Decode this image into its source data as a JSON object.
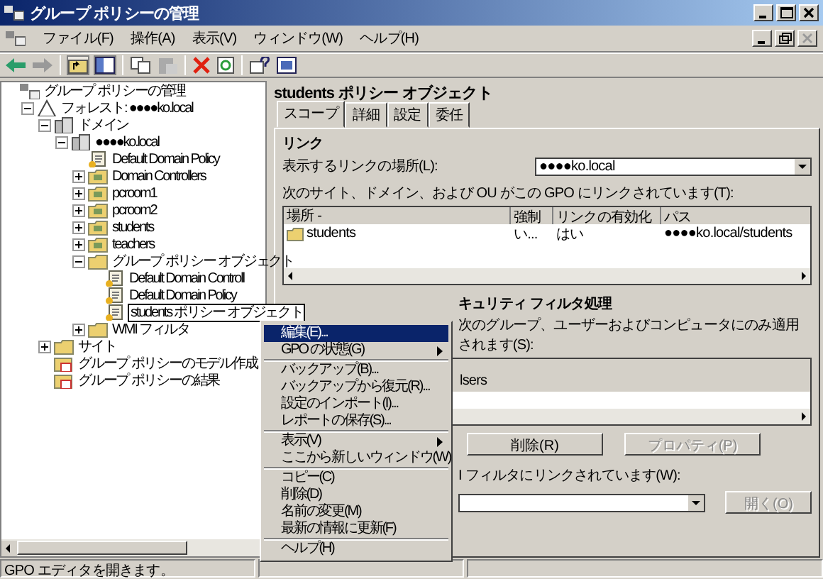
{
  "window": {
    "title": "グループ ポリシーの管理"
  },
  "menu_bar": [
    "ファイル(F)",
    "操作(A)",
    "表示(V)",
    "ウィンドウ(W)",
    "ヘルプ(H)"
  ],
  "tree": [
    {
      "label": "グループ ポリシーの管理",
      "kind": "root",
      "selected": false,
      "children": [
        {
          "label": "フォレスト: ●●●●ko.local",
          "kind": "forest",
          "expanded": true,
          "selected": false,
          "children": [
            {
              "label": "ドメイン",
              "kind": "domains",
              "expanded": true,
              "selected": false,
              "children": [
                {
                  "label": "●●●●ko.local",
                  "kind": "domain",
                  "expanded": true,
                  "selected": false,
                  "children": [
                    {
                      "label": "Default Domain Policy",
                      "kind": "gpo",
                      "selected": false
                    },
                    {
                      "label": "Domain Controllers",
                      "kind": "ou",
                      "expanded": false,
                      "selected": false
                    },
                    {
                      "label": "pcroom1",
                      "kind": "ou",
                      "expanded": false,
                      "selected": false
                    },
                    {
                      "label": "pcroom2",
                      "kind": "ou",
                      "expanded": false,
                      "selected": false
                    },
                    {
                      "label": "students",
                      "kind": "ou",
                      "expanded": false,
                      "selected": false
                    },
                    {
                      "label": "teachers",
                      "kind": "ou",
                      "expanded": false,
                      "selected": false
                    },
                    {
                      "label": "グループ ポリシー オブジェクト",
                      "kind": "folder",
                      "expanded": true,
                      "selected": false,
                      "children": [
                        {
                          "label": "Default Domain Controll",
                          "kind": "gpo",
                          "selected": false
                        },
                        {
                          "label": "Default Domain Policy",
                          "kind": "gpo",
                          "selected": false
                        },
                        {
                          "label": "students ポリシー オブジェクト",
                          "kind": "gpo",
                          "selected": true
                        }
                      ]
                    },
                    {
                      "label": "WMI フィルタ",
                      "kind": "folder",
                      "expanded": false,
                      "selected": false
                    }
                  ]
                }
              ]
            },
            {
              "label": "サイト",
              "kind": "folder",
              "expanded": false,
              "selected": false
            },
            {
              "label": "グループ ポリシーのモデル作成",
              "kind": "report",
              "selected": false
            },
            {
              "label": "グループ ポリシーの結果",
              "kind": "report",
              "selected": false
            }
          ]
        }
      ]
    }
  ],
  "details": {
    "title": "students ポリシー オブジェクト",
    "tabs": [
      {
        "label": "スコープ",
        "selected": true
      },
      {
        "label": "詳細",
        "selected": false
      },
      {
        "label": "設定",
        "selected": false
      },
      {
        "label": "委任",
        "selected": false
      }
    ],
    "links_heading": "リンク",
    "location_label": "表示するリンクの場所(L):",
    "location_value": "●●●●ko.local",
    "links_caption": "次のサイト、ドメイン、および OU がこの GPO にリンクされています(T):",
    "links_table": {
      "columns": [
        "場所  -",
        "強制",
        "リンクの有効化",
        "パス"
      ],
      "rows": [
        [
          "students",
          "い...",
          "はい",
          "●●●●ko.local/students"
        ]
      ]
    },
    "security_heading": "キュリティ フィルタ処理",
    "security_caption": "次のグループ、ユーザーおよびコンピュータにのみ適用されます(S):",
    "security_rows": [
      "lsers"
    ],
    "buttons": [
      {
        "label": "削除(R)",
        "disabled": false
      },
      {
        "label": "プロパティ(P)",
        "disabled": true
      }
    ],
    "wmi_caption": "I フィルタにリンクされています(W):",
    "open_button": {
      "label": "開く(O)",
      "disabled": true
    }
  },
  "context_menu": [
    {
      "label": "編集(E)...",
      "kind": "item",
      "selected": true
    },
    {
      "label": "GPO の状態(G)",
      "kind": "submenu",
      "selected": false
    },
    {
      "kind": "separator"
    },
    {
      "label": "バックアップ(B)...",
      "kind": "item",
      "selected": false
    },
    {
      "label": "バックアップから復元(R)...",
      "kind": "item",
      "selected": false
    },
    {
      "label": "設定のインポート(I)...",
      "kind": "item",
      "selected": false
    },
    {
      "label": "レポートの保存(S)...",
      "kind": "item",
      "selected": false
    },
    {
      "kind": "separator"
    },
    {
      "label": "表示(V)",
      "kind": "submenu",
      "selected": false
    },
    {
      "label": "ここから新しいウィンドウ(W)",
      "kind": "item",
      "selected": false
    },
    {
      "kind": "separator"
    },
    {
      "label": "コピー(C)",
      "kind": "item",
      "selected": false
    },
    {
      "label": "削除(D)",
      "kind": "item",
      "selected": false
    },
    {
      "label": "名前の変更(M)",
      "kind": "item",
      "selected": false
    },
    {
      "label": "最新の情報に更新(F)",
      "kind": "item",
      "selected": false
    },
    {
      "kind": "separator"
    },
    {
      "label": "ヘルプ(H)",
      "kind": "item",
      "selected": false
    }
  ],
  "status_bar": "GPO エディタを開きます。"
}
